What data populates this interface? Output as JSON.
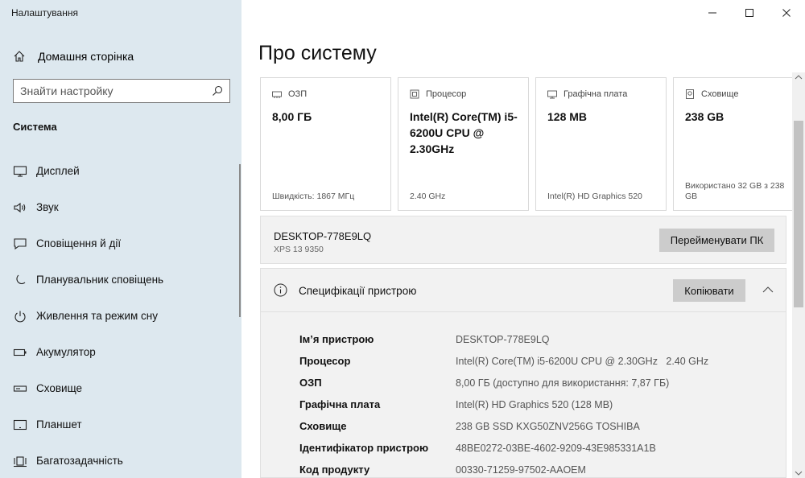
{
  "app": {
    "title": "Налаштування"
  },
  "sidebar": {
    "home_label": "Домашня сторінка",
    "search_placeholder": "Знайти настройку",
    "section_title": "Система",
    "items": [
      {
        "label": "Дисплей",
        "icon": "monitor-icon"
      },
      {
        "label": "Звук",
        "icon": "speaker-icon"
      },
      {
        "label": "Сповіщення й дії",
        "icon": "notification-icon"
      },
      {
        "label": "Планувальник сповіщень",
        "icon": "moon-icon"
      },
      {
        "label": "Живлення та режим сну",
        "icon": "power-icon"
      },
      {
        "label": "Акумулятор",
        "icon": "battery-icon"
      },
      {
        "label": "Сховище",
        "icon": "storage-icon"
      },
      {
        "label": "Планшет",
        "icon": "tablet-icon"
      },
      {
        "label": "Багатозадачність",
        "icon": "multitasking-icon"
      }
    ]
  },
  "main": {
    "title": "Про систему",
    "cards": [
      {
        "header": "ОЗП",
        "icon": "ram-icon",
        "value": "8,00 ГБ",
        "sub": "Швидкість: 1867 МГц"
      },
      {
        "header": "Процесор",
        "icon": "cpu-icon",
        "value": "Intel(R) Core(TM) i5-6200U CPU @ 2.30GHz",
        "sub": "2.40 GHz"
      },
      {
        "header": "Графічна плата",
        "icon": "gpu-icon",
        "value": "128 MB",
        "sub": "Intel(R) HD Graphics 520"
      },
      {
        "header": "Сховище",
        "icon": "storage-card-icon",
        "value": "238 GB",
        "sub": "Використано 32 GB з 238 GB"
      }
    ],
    "device": {
      "name": "DESKTOP-778E9LQ",
      "model": "XPS 13 9350",
      "rename_label": "Перейменувати ПК"
    },
    "specs": {
      "title": "Специфікації пристрою",
      "copy_label": "Копіювати",
      "rows": [
        {
          "key": "Ім’я пристрою",
          "value": "DESKTOP-778E9LQ"
        },
        {
          "key": "Процесор",
          "value": "Intel(R) Core(TM) i5-6200U CPU @ 2.30GHz   2.40 GHz"
        },
        {
          "key": "ОЗП",
          "value": "8,00 ГБ (доступно для використання: 7,87 ГБ)"
        },
        {
          "key": "Графічна плата",
          "value": "Intel(R) HD Graphics 520 (128 MB)"
        },
        {
          "key": "Сховище",
          "value": "238 GB SSD KXG50ZNV256G TOSHIBA"
        },
        {
          "key": "Ідентифікатор пристрою",
          "value": "48BE0272-03BE-4602-9209-43E985331A1B"
        },
        {
          "key": "Код продукту",
          "value": "00330-71259-97502-AAOEM"
        }
      ]
    }
  }
}
